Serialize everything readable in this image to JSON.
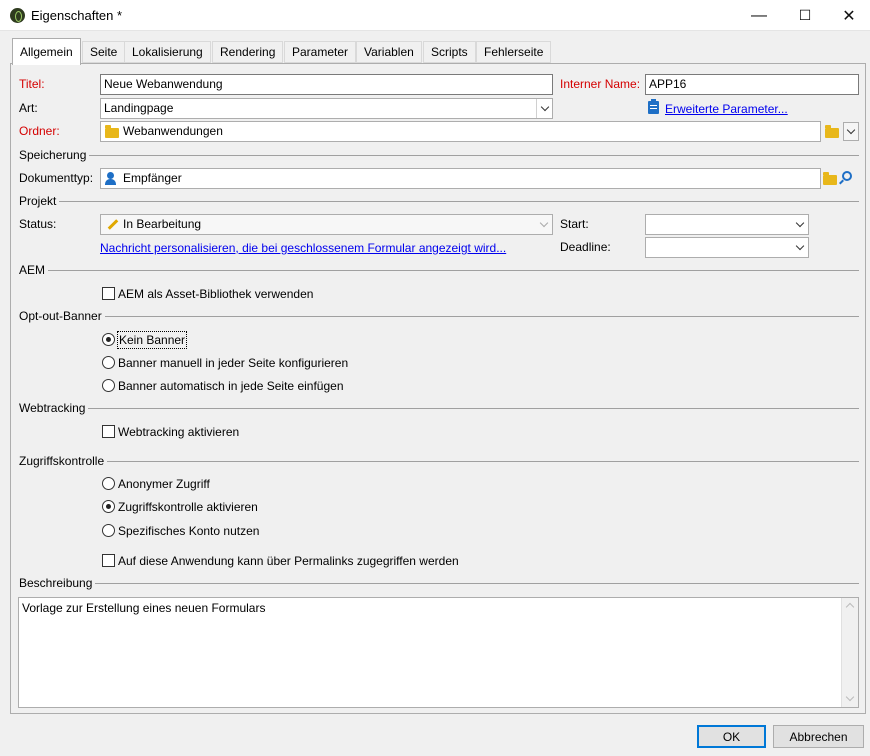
{
  "window": {
    "title": "Eigenschaften *",
    "minimize": "—",
    "maximize": "☐",
    "close": "✕"
  },
  "tabs": [
    {
      "label": "Allgemein",
      "active": true
    },
    {
      "label": "Seite"
    },
    {
      "label": "Lokalisierung"
    },
    {
      "label": "Rendering"
    },
    {
      "label": "Parameter"
    },
    {
      "label": "Variablen"
    },
    {
      "label": "Scripts"
    },
    {
      "label": "Fehlerseite"
    }
  ],
  "form": {
    "title_label": "Titel:",
    "title_value": "Neue Webanwendung",
    "internal_name_label": "Interner Name:",
    "internal_name_value": "APP16",
    "type_label": "Art:",
    "type_value": "Landingpage",
    "advanced_params_link": "Erweiterte Parameter...",
    "folder_label": "Ordner:",
    "folder_value": "Webanwendungen"
  },
  "storage": {
    "section": "Speicherung",
    "doctype_label": "Dokumenttyp:",
    "doctype_value": "Empfänger"
  },
  "project": {
    "section": "Projekt",
    "status_label": "Status:",
    "status_value": "In Bearbeitung",
    "personalize_link": "Nachricht personalisieren, die bei geschlossenem Formular angezeigt wird...",
    "start_label": "Start:",
    "start_value": "",
    "deadline_label": "Deadline:",
    "deadline_value": ""
  },
  "aem": {
    "section": "AEM",
    "asset_library_label": "AEM als Asset-Bibliothek verwenden",
    "asset_library_checked": false
  },
  "optout": {
    "section": "Opt-out-Banner",
    "options": [
      {
        "label": "Kein Banner",
        "selected": true
      },
      {
        "label": "Banner manuell in jeder Seite konfigurieren",
        "selected": false
      },
      {
        "label": "Banner automatisch in jede Seite einfügen",
        "selected": false
      }
    ]
  },
  "webtracking": {
    "section": "Webtracking",
    "enable_label": "Webtracking aktivieren",
    "enable_checked": false
  },
  "access": {
    "section": "Zugriffskontrolle",
    "options": [
      {
        "label": "Anonymer Zugriff",
        "selected": false
      },
      {
        "label": "Zugriffskontrolle aktivieren",
        "selected": true
      },
      {
        "label": "Spezifisches Konto nutzen",
        "selected": false
      }
    ],
    "permalink_label": "Auf diese Anwendung kann über Permalinks zugegriffen werden",
    "permalink_checked": false
  },
  "description": {
    "section": "Beschreibung",
    "text": "Vorlage zur Erstellung eines neuen Formulars"
  },
  "footer": {
    "ok_label": "OK",
    "cancel_label": "Abbrechen"
  },
  "colors": {
    "required_label": "#d40000",
    "link": "#0000ee",
    "accent": "#0078d7",
    "folder": "#e8b71a"
  }
}
